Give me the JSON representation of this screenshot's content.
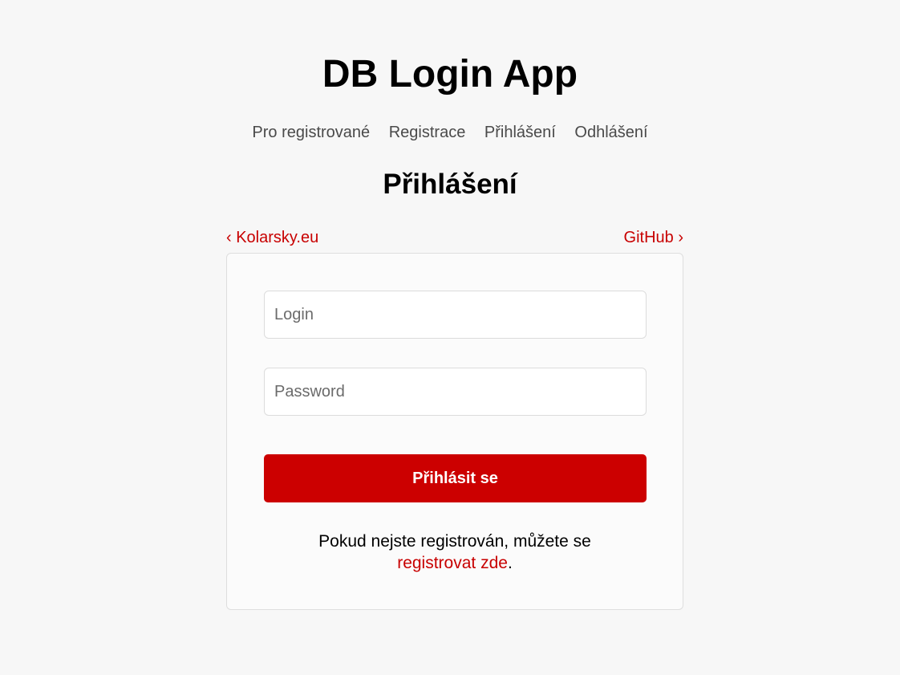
{
  "app": {
    "title": "DB Login App"
  },
  "nav": {
    "items": [
      {
        "label": "Pro registrované"
      },
      {
        "label": "Registrace"
      },
      {
        "label": "Přihlášení"
      },
      {
        "label": "Odhlášení"
      }
    ]
  },
  "page": {
    "heading": "Přihlášení"
  },
  "links": {
    "back": "‹ Kolarsky.eu",
    "github": "GitHub ›"
  },
  "form": {
    "login_placeholder": "Login",
    "login_value": "",
    "password_placeholder": "Password",
    "password_value": "",
    "submit_label": "Přihlásit se"
  },
  "register_note": {
    "text": "Pokud nejste registrován, můžete se",
    "link": "registrovat zde",
    "suffix": "."
  },
  "colors": {
    "accent": "#cc0000",
    "link": "#c80000",
    "background": "#f7f7f7",
    "card": "#fbfbfb"
  }
}
